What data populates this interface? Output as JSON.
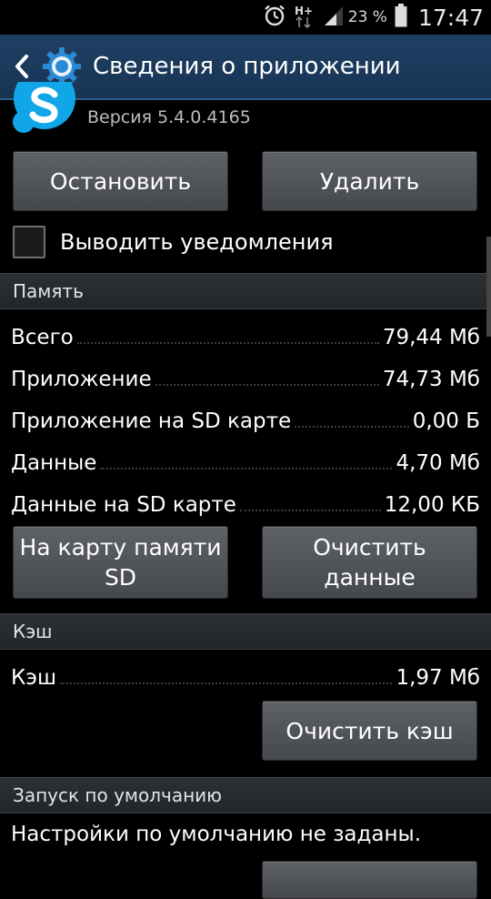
{
  "status_bar": {
    "time": "17:47",
    "battery_percent": "23 %",
    "network": "H+",
    "icons": [
      "alarm-clock-icon",
      "hplus-icon",
      "signal-icon",
      "battery-icon"
    ]
  },
  "action_bar": {
    "title": "Сведения о приложении",
    "icons": [
      "back-chevron-icon",
      "settings-gear-icon"
    ]
  },
  "app": {
    "version": "Версия 5.4.0.4165",
    "icon": "skype-icon"
  },
  "actions": {
    "stop": "Остановить",
    "uninstall": "Удалить"
  },
  "notifications": {
    "label": "Выводить уведомления",
    "checked": false
  },
  "memory": {
    "header": "Память",
    "rows": [
      {
        "label": "Всего",
        "value": "79,44 Мб"
      },
      {
        "label": "Приложение",
        "value": "74,73 Мб"
      },
      {
        "label": "Приложение на SD карте",
        "value": "0,00 Б"
      },
      {
        "label": "Данные",
        "value": "4,70 Мб"
      },
      {
        "label": "Данные на SD карте",
        "value": "12,00 КБ"
      }
    ],
    "move_sd_line1": "На карту памяти",
    "move_sd_line2": "SD",
    "clear_data_line1": "Очистить",
    "clear_data_line2": "данные"
  },
  "cache": {
    "header": "Кэш",
    "label": "Кэш",
    "value": "1,97 Мб",
    "clear_cache": "Очистить кэш"
  },
  "launch_default": {
    "header": "Запуск по умолчанию",
    "text": "Настройки по умолчанию не заданы."
  },
  "colors": {
    "action_bar": "#1f3f63",
    "button": "#54575b",
    "section_header": "#2a2e33"
  }
}
